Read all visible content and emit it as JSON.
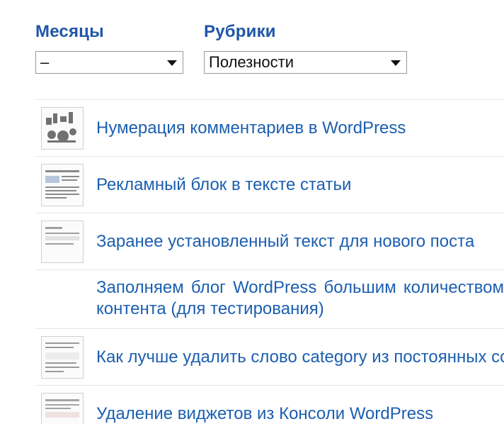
{
  "filters": {
    "months": {
      "label": "Месяцы",
      "selected": "–"
    },
    "categories": {
      "label": "Рубрики",
      "selected": "Полезности"
    }
  },
  "posts": [
    {
      "title": "Нумерация комментариев в WordPress",
      "thumbnail": true
    },
    {
      "title": "Рекламный блок в тексте статьи",
      "thumbnail": true
    },
    {
      "title": "Заранее установленный текст для нового поста",
      "thumbnail": true
    },
    {
      "title": "Заполняем блог WordPress большим количеством контента (для тестирования)",
      "thumbnail": false
    },
    {
      "title": "Как лучше удалить слово category из постоянных ссылок",
      "thumbnail": true
    },
    {
      "title": "Удаление виджетов из Консоли WordPress",
      "thumbnail": true
    }
  ]
}
